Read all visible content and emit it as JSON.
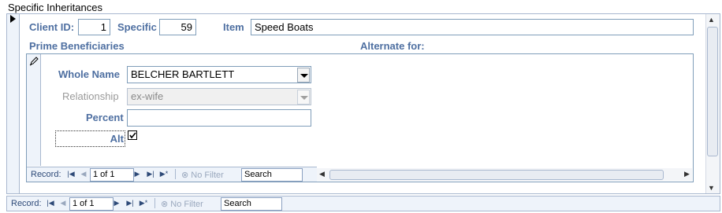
{
  "form": {
    "title": "Specific Inheritances",
    "client_id_label": "Client ID:",
    "client_id_value": "1",
    "specific_label": "Specific",
    "specific_value": "59",
    "item_label": "Item",
    "item_value": "Speed Boats",
    "prime_beneficiaries_label": "Prime Beneficiaries",
    "alternate_for_label": "Alternate for:"
  },
  "subform": {
    "whole_name_label": "Whole Name",
    "whole_name_value": "BELCHER BARTLETT",
    "relationship_label": "Relationship",
    "relationship_value": "ex-wife",
    "percent_label": "Percent",
    "percent_value": "",
    "alt_label": "Alt",
    "alt_checked": true,
    "nav": {
      "record_label": "Record:",
      "position": "1 of 1",
      "filter_label": "No Filter",
      "search_placeholder": "Search"
    }
  },
  "main_nav": {
    "record_label": "Record:",
    "position": "1 of 1",
    "filter_label": "No Filter",
    "search_placeholder": "Search"
  },
  "icons": {
    "record_selector": "triangle-right-icon",
    "edit_pencil": "pencil-icon",
    "first": "first-record-icon",
    "prev": "previous-record-icon",
    "next": "next-record-icon",
    "last": "last-record-icon",
    "new": "new-record-icon",
    "filter": "filter-icon"
  },
  "colors": {
    "label_blue": "#4e6fa1",
    "border": "#7f9db9",
    "nav_bg": "#eef3fa"
  }
}
